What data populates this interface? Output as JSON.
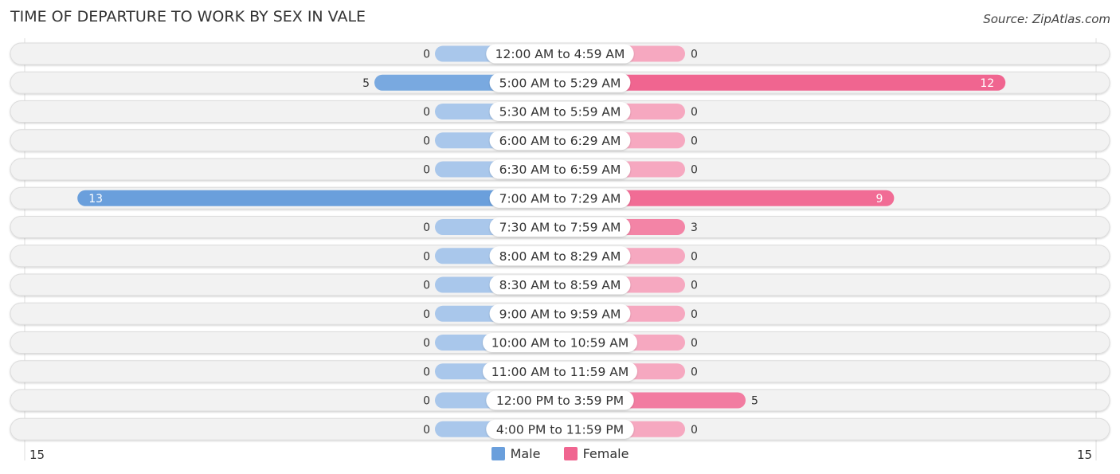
{
  "header": {
    "title": "TIME OF DEPARTURE TO WORK BY SEX IN VALE",
    "source": "Source: ZipAtlas.com"
  },
  "colors": {
    "male_strong": "#6a9fdc",
    "male_light": "#a9c7eb",
    "female_strong": "#f06590",
    "female_light": "#f6a8c0",
    "row_bg": "#f2f2f2"
  },
  "legend": {
    "male_label": "Male",
    "female_label": "Female"
  },
  "axis": {
    "left_label": "15",
    "right_label": "15"
  },
  "chart_data": {
    "type": "bar",
    "orientation": "horizontal-diverging",
    "title": "TIME OF DEPARTURE TO WORK BY SEX IN VALE",
    "categories": [
      "12:00 AM to 4:59 AM",
      "5:00 AM to 5:29 AM",
      "5:30 AM to 5:59 AM",
      "6:00 AM to 6:29 AM",
      "6:30 AM to 6:59 AM",
      "7:00 AM to 7:29 AM",
      "7:30 AM to 7:59 AM",
      "8:00 AM to 8:29 AM",
      "8:30 AM to 8:59 AM",
      "9:00 AM to 9:59 AM",
      "10:00 AM to 10:59 AM",
      "11:00 AM to 11:59 AM",
      "12:00 PM to 3:59 PM",
      "4:00 PM to 11:59 PM"
    ],
    "series": [
      {
        "name": "Male",
        "values": [
          0,
          5,
          0,
          0,
          0,
          13,
          0,
          0,
          0,
          0,
          0,
          0,
          0,
          0
        ]
      },
      {
        "name": "Female",
        "values": [
          0,
          12,
          0,
          0,
          0,
          9,
          3,
          0,
          0,
          0,
          0,
          0,
          5,
          0
        ]
      }
    ],
    "xlim": [
      -15,
      15
    ],
    "tick_labels": [
      "15",
      "15"
    ],
    "legend_position": "bottom-center",
    "grid": false
  }
}
